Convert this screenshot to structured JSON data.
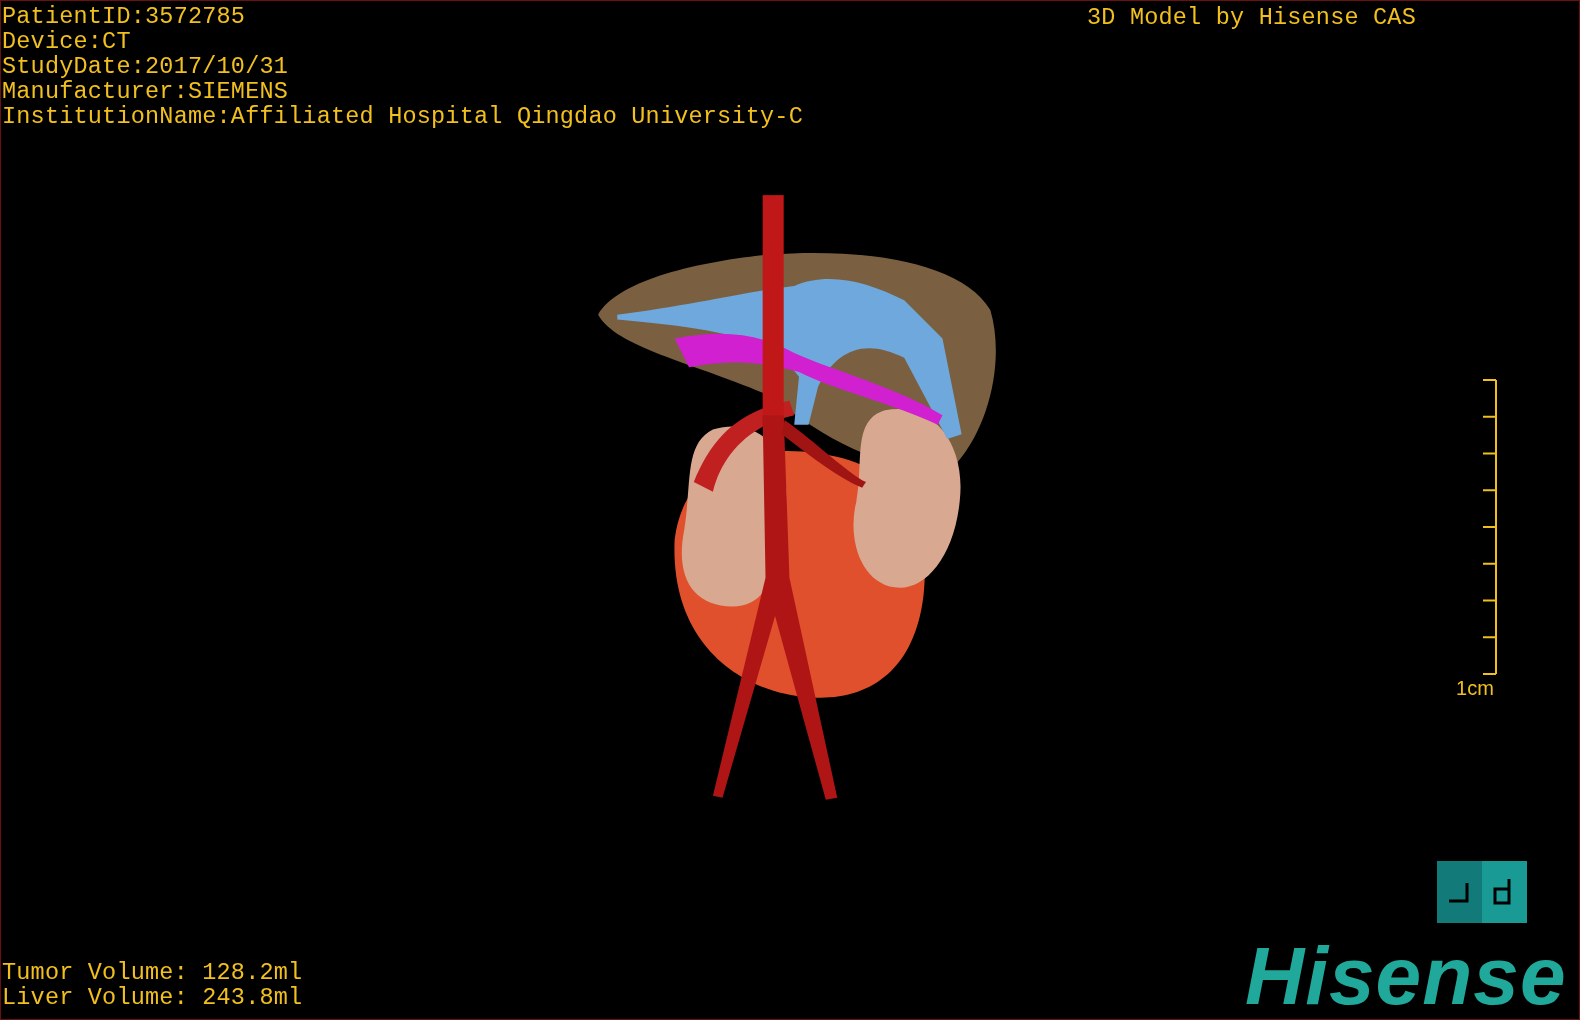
{
  "study_info": [
    "PatientID:3572785",
    "Device:CT",
    "StudyDate:2017/10/31",
    "Manufacturer:SIEMENS",
    "InstitutionName:Affiliated Hospital Qingdao University-C"
  ],
  "credit": "3D Model by Hisense CAS",
  "scale_bar": {
    "label": "1cm"
  },
  "volumes": [
    "Tumor Volume: 128.2ml",
    "Liver Volume: 243.8ml"
  ],
  "logo": "Hisense"
}
